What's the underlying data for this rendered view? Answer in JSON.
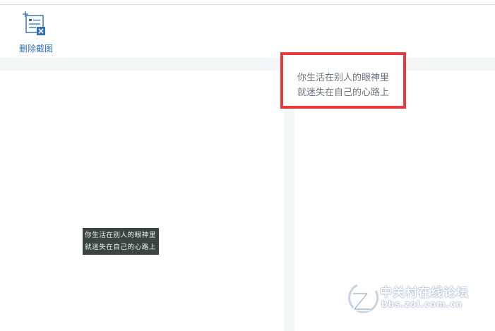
{
  "toolbar": {
    "delete_screenshot": {
      "label": "删除截图",
      "icon": "delete-screenshot-icon"
    }
  },
  "result_panel": {
    "lines": [
      "你生活在别人的眼神里",
      "就迷失在自己的心路上"
    ],
    "highlight_color": "#e63a3f"
  },
  "screenshot_panel": {
    "captured_lines": [
      "你生活在别人的眼神里",
      "就迷失在自己的心路上"
    ]
  },
  "watermark": {
    "title": "中关村在线论坛",
    "url": "bbs.zol.com.cn"
  },
  "colors": {
    "accent": "#2f6fb3",
    "panel_bg": "#f5f6f8",
    "capture_bg": "#3a4440"
  }
}
